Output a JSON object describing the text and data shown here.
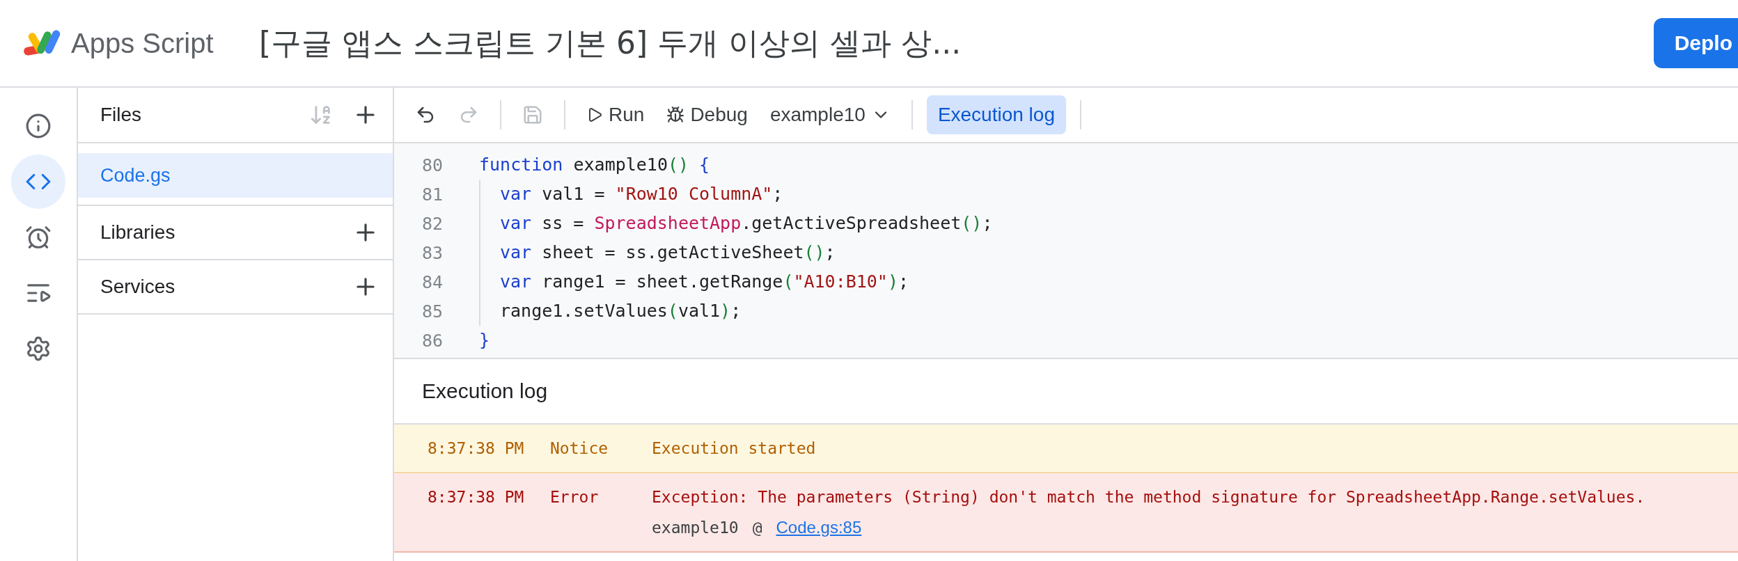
{
  "header": {
    "product": "Apps Script",
    "title": "[구글 앱스 스크립트 기본 6] 두개 이상의 셀과 상...",
    "deploy_button": "Deplo"
  },
  "rail": [
    {
      "kind": "info",
      "selected": false
    },
    {
      "kind": "code",
      "selected": true
    },
    {
      "kind": "triggers",
      "selected": false
    },
    {
      "kind": "executions",
      "selected": false
    },
    {
      "kind": "settings",
      "selected": false
    }
  ],
  "files_panel": {
    "title": "Files",
    "items": [
      {
        "name": "Code.gs",
        "selected": true
      }
    ],
    "sections": [
      "Libraries",
      "Services"
    ]
  },
  "toolbar": {
    "undo": {
      "disabled": false
    },
    "redo": {
      "disabled": true
    },
    "save": {
      "disabled": true
    },
    "run": "Run",
    "debug": "Debug",
    "function": "example10",
    "log_button": {
      "label": "Execution log",
      "selected": true
    }
  },
  "code": [
    {
      "number": "80",
      "indented": false,
      "tokens": [
        {
          "kind": "keyword",
          "text": "function"
        },
        {
          "kind": "plain",
          "text": " example10"
        },
        {
          "kind": "paren",
          "text": "()"
        },
        {
          "kind": "keyword",
          "text": " {"
        }
      ]
    },
    {
      "number": "81",
      "indented": true,
      "tokens": [
        {
          "kind": "keyword",
          "text": "var"
        },
        {
          "kind": "plain",
          "text": " val1 = "
        },
        {
          "kind": "string",
          "text": "\"Row10 ColumnA\""
        },
        {
          "kind": "plain",
          "text": ";"
        }
      ]
    },
    {
      "number": "82",
      "indented": true,
      "tokens": [
        {
          "kind": "keyword",
          "text": "var"
        },
        {
          "kind": "plain",
          "text": " ss = "
        },
        {
          "kind": "class",
          "text": "SpreadsheetApp"
        },
        {
          "kind": "plain",
          "text": ".getActiveSpreadsheet"
        },
        {
          "kind": "paren",
          "text": "()"
        },
        {
          "kind": "plain",
          "text": ";"
        }
      ]
    },
    {
      "number": "83",
      "indented": true,
      "tokens": [
        {
          "kind": "keyword",
          "text": "var"
        },
        {
          "kind": "plain",
          "text": " sheet = ss.getActiveSheet"
        },
        {
          "kind": "paren",
          "text": "()"
        },
        {
          "kind": "plain",
          "text": ";"
        }
      ]
    },
    {
      "number": "84",
      "indented": true,
      "tokens": [
        {
          "kind": "keyword",
          "text": "var"
        },
        {
          "kind": "plain",
          "text": " range1 = sheet.getRange"
        },
        {
          "kind": "paren",
          "text": "("
        },
        {
          "kind": "string",
          "text": "\"A10:B10\""
        },
        {
          "kind": "paren",
          "text": ")"
        },
        {
          "kind": "plain",
          "text": ";"
        }
      ]
    },
    {
      "number": "85",
      "indented": true,
      "tokens": [
        {
          "kind": "plain",
          "text": "range1.setValues"
        },
        {
          "kind": "paren",
          "text": "("
        },
        {
          "kind": "plain",
          "text": "val1"
        },
        {
          "kind": "paren",
          "text": ")"
        },
        {
          "kind": "plain",
          "text": ";"
        }
      ]
    },
    {
      "number": "86",
      "indented": false,
      "tokens": [
        {
          "kind": "keyword",
          "text": "}"
        }
      ]
    }
  ],
  "execution_log": {
    "title": "Execution log",
    "entries": [
      {
        "kind": "notice",
        "time": "8:37:38 PM",
        "label": "Notice",
        "message": "Execution started"
      },
      {
        "kind": "error",
        "time": "8:37:38 PM",
        "label": "Error",
        "message": "Exception: The parameters (String) don't match the method signature for SpreadsheetApp.Range.setValues.",
        "trace": {
          "function": "example10",
          "at": "@",
          "link": "Code.gs:85"
        }
      }
    ]
  }
}
